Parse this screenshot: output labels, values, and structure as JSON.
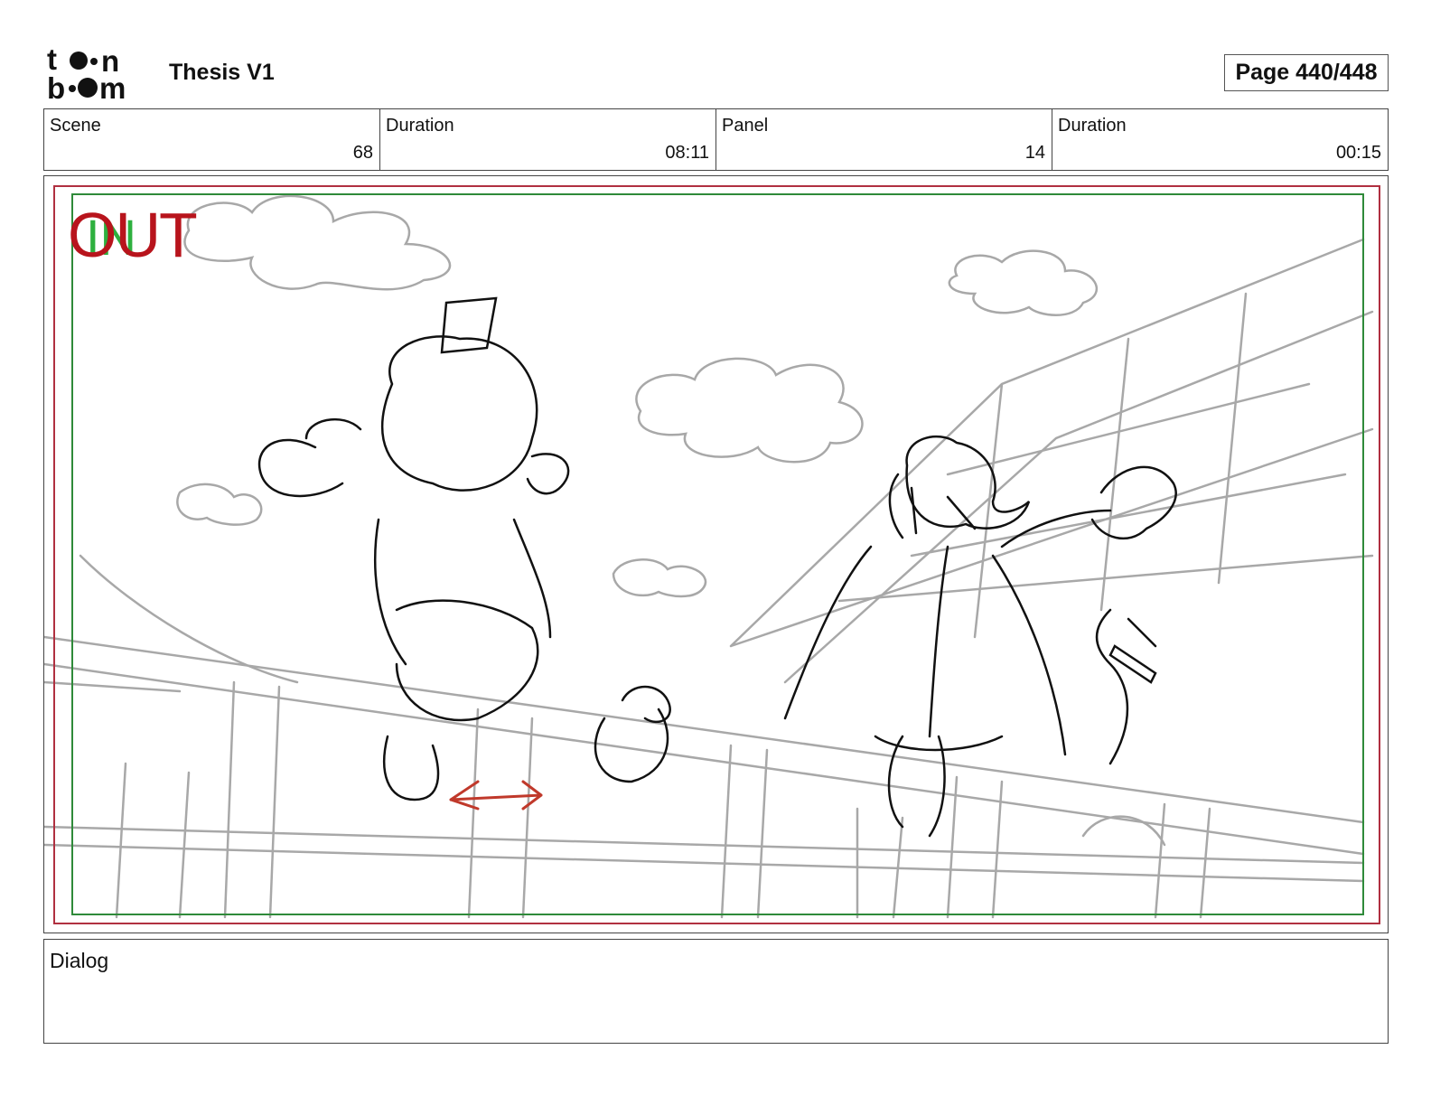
{
  "header": {
    "logo_text": "toonboom",
    "project_title": "Thesis V1",
    "page_label": "Page 440/448"
  },
  "meta": {
    "scene_label": "Scene",
    "scene_value": "68",
    "scene_duration_label": "Duration",
    "scene_duration_value": "08:11",
    "panel_label": "Panel",
    "panel_value": "14",
    "panel_duration_label": "Duration",
    "panel_duration_value": "00:15"
  },
  "panel": {
    "safe_area_in_label": "IN",
    "safe_area_out_label": "OUT"
  },
  "dialog": {
    "label": "Dialog",
    "text": ""
  },
  "colors": {
    "out_guide": "#b03040",
    "in_guide": "#2f8a3a",
    "camera_arrow": "#c0392b"
  }
}
